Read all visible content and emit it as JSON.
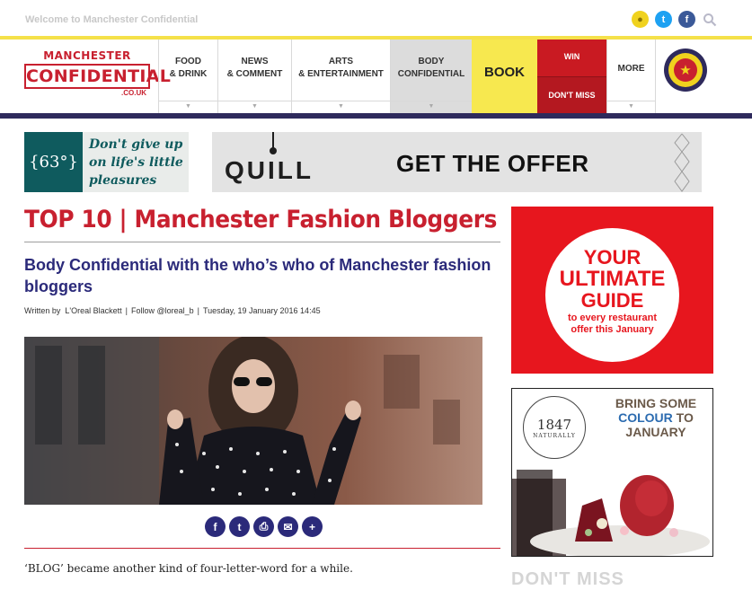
{
  "topbar": {
    "welcome": "Welcome to Manchester Confidential",
    "icons": [
      "user-icon",
      "twitter-icon",
      "facebook-icon",
      "search-icon"
    ]
  },
  "logo": {
    "line1": "MANCHESTER",
    "line2": "CONFIDENTIAL",
    "line3": ".CO.UK"
  },
  "nav": {
    "items": [
      {
        "label": "FOOD\n& DRINK"
      },
      {
        "label": "NEWS\n& COMMENT"
      },
      {
        "label": "ARTS\n& ENTERTAINMENT"
      },
      {
        "label": "BODY\nCONFIDENTIAL"
      },
      {
        "label": "BOOK"
      },
      {
        "label": "WIN"
      },
      {
        "label": "DON'T MISS"
      },
      {
        "label": "MORE"
      }
    ]
  },
  "ads": {
    "ad63_badge": "{63°}",
    "ad63_text": "Don't give up\non life's little\npleasures",
    "quill_brand": "QUILL",
    "quill_cta": "GET THE OFFER",
    "red_ad": {
      "l1": "YOUR",
      "l2": "ULTIMATE",
      "l3": "GUIDE",
      "l4": "to every restaurant",
      "l5": "offer this January"
    },
    "ad1847": {
      "logo": "1847",
      "logo_sub": "NATURALLY",
      "h1": "BRING SOME",
      "h2": "COLOUR",
      "h3": "TO",
      "h4": "JANUARY"
    }
  },
  "article": {
    "headline": "TOP 10 | Manchester Fashion Bloggers",
    "subhead": "Body Confidential with the who’s who of Manchester fashion bloggers",
    "byline_prefix": "Written by",
    "author": "L'Oreal Blackett",
    "follow": "Follow @loreal_b",
    "date": "Tuesday, 19 January 2016 14:45",
    "paragraph": "‘BLOG’ became another kind of four-letter-word for a while."
  },
  "share": {
    "buttons": [
      "facebook-icon",
      "twitter-icon",
      "print-icon",
      "email-icon",
      "more-icon"
    ],
    "glyphs": [
      "f",
      "t",
      "⎙",
      "✉",
      "+"
    ]
  },
  "sidebar": {
    "dontmiss_heading": "DON'T MISS"
  },
  "colors": {
    "brand_red": "#c8202f",
    "nav_navy": "#2e2a5c",
    "accent_yellow": "#f7e84f"
  }
}
